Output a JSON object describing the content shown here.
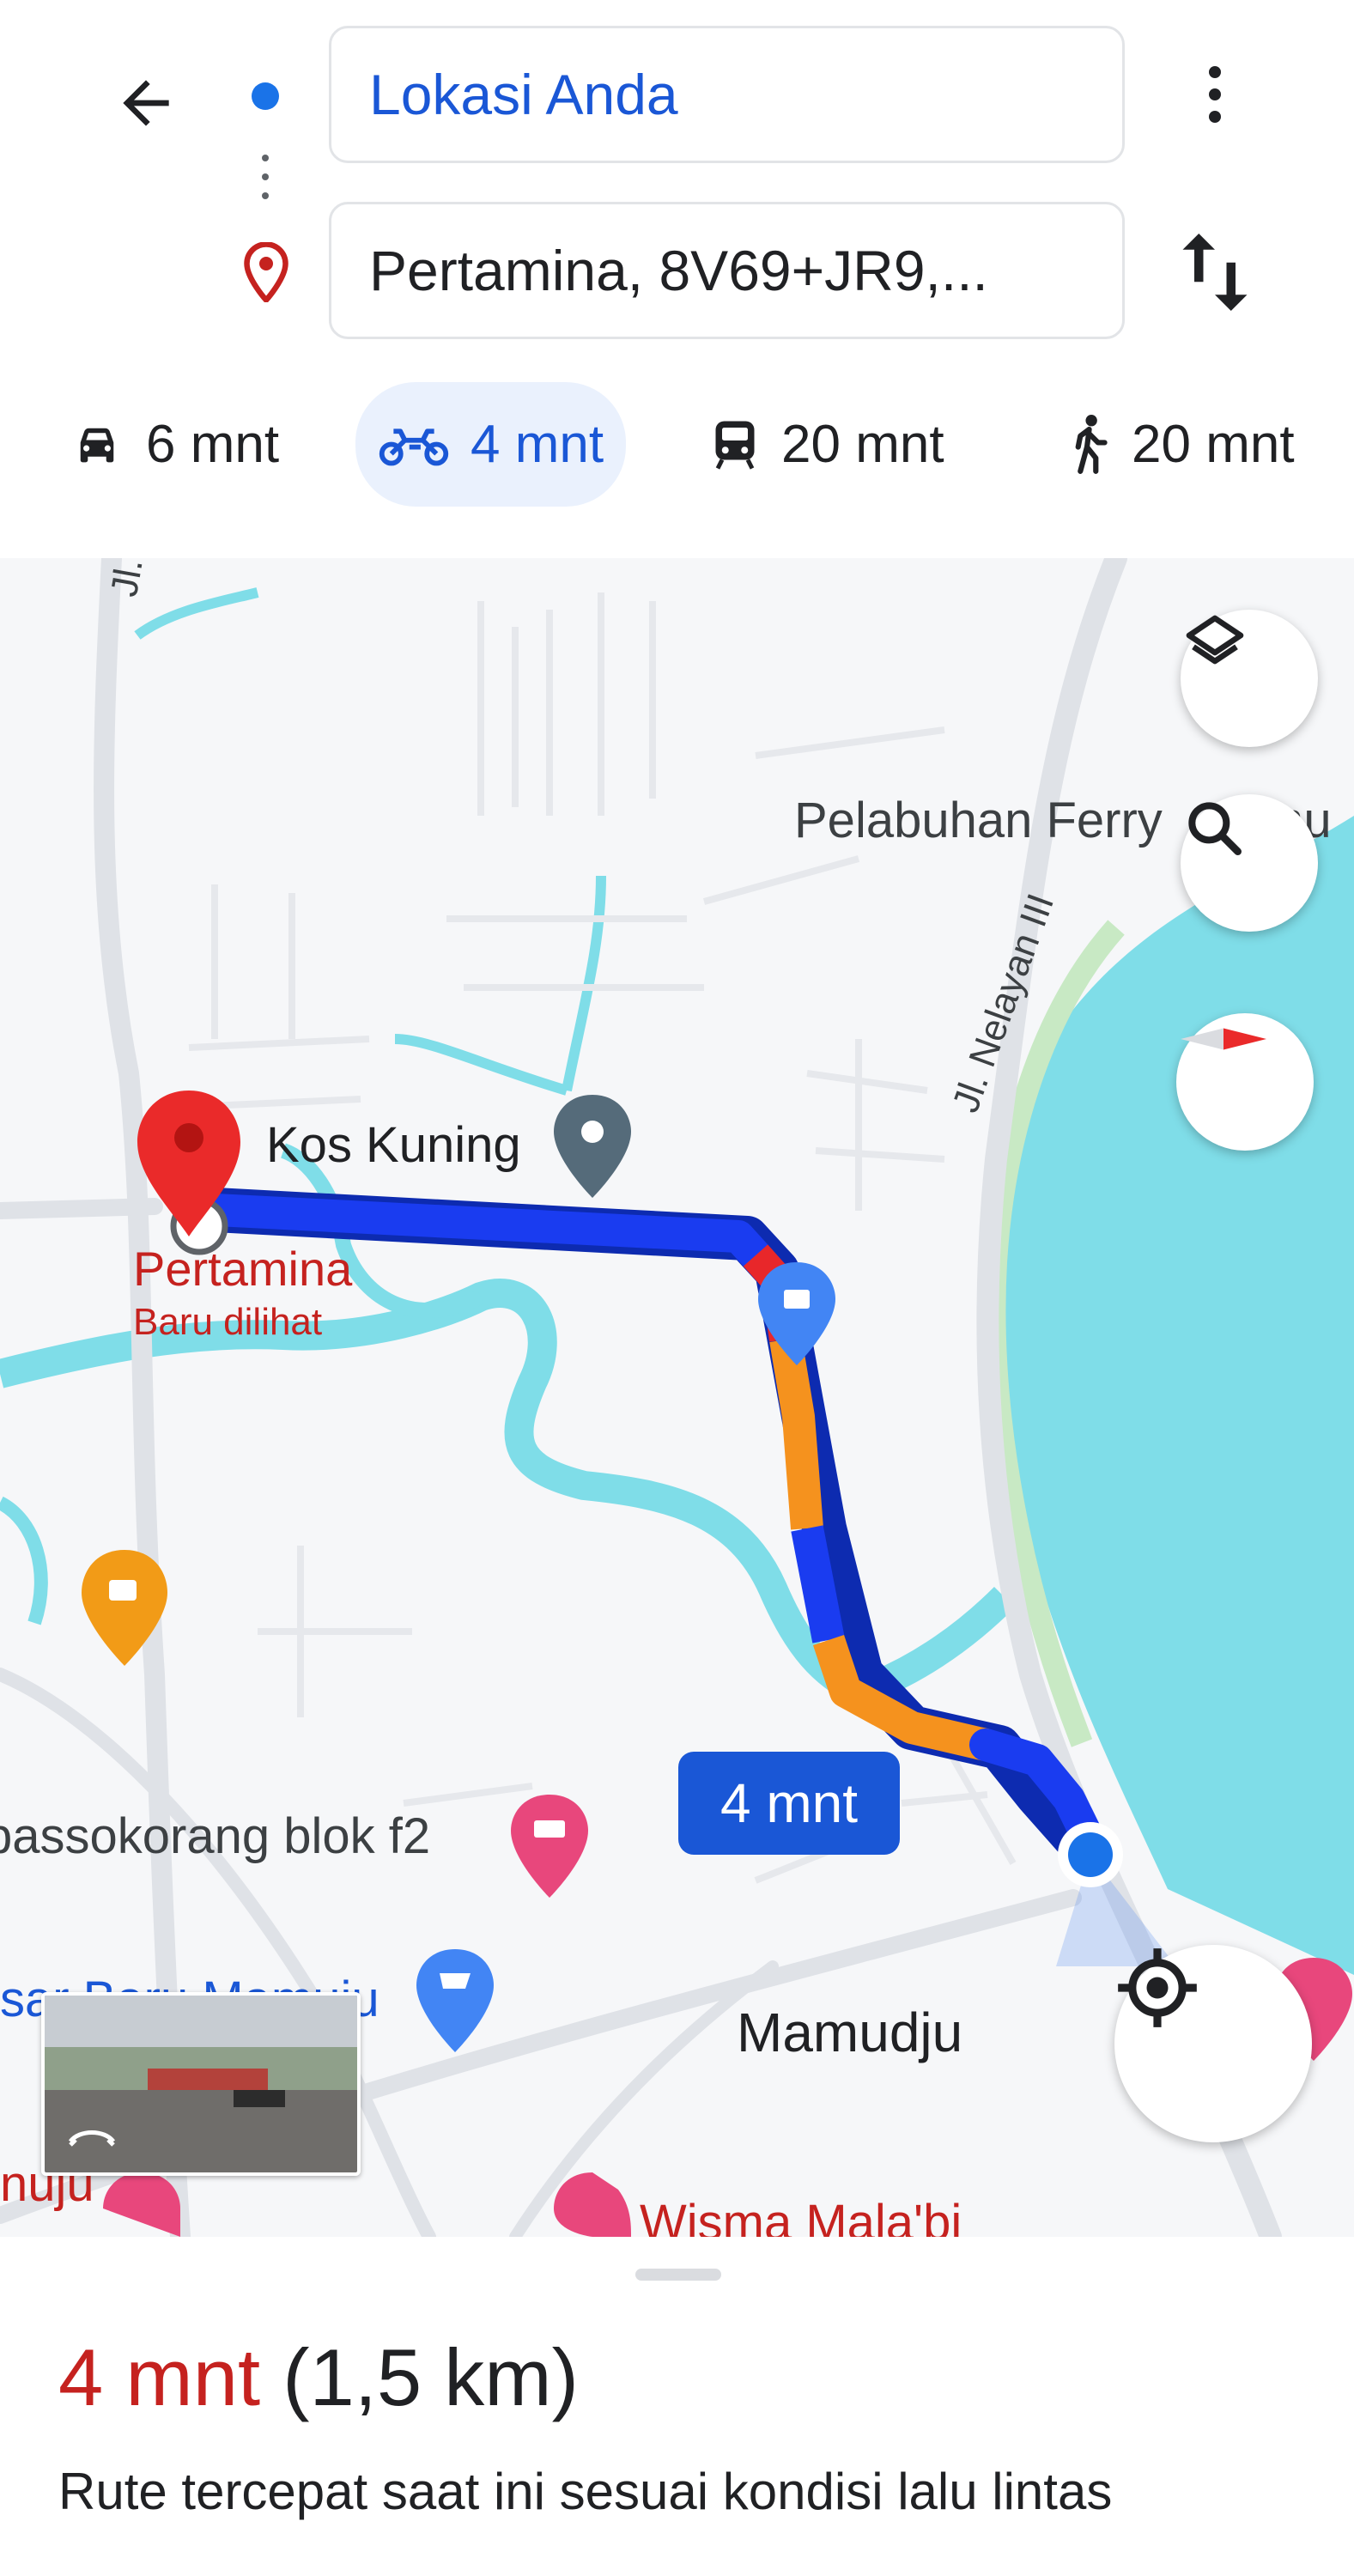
{
  "header": {
    "origin": "Lokasi Anda",
    "destination": "Pertamina, 8V69+JR9,..."
  },
  "modes": [
    {
      "icon": "car-icon",
      "label": "6 mnt",
      "active": false
    },
    {
      "icon": "motorcycle-icon",
      "label": "4 mnt",
      "active": true
    },
    {
      "icon": "transit-icon",
      "label": "20 mnt",
      "active": false
    },
    {
      "icon": "walk-icon",
      "label": "20 mnt",
      "active": false
    }
  ],
  "map": {
    "labels": {
      "street_top": "Jl. I",
      "ferry": "Pelabuhan Ferry",
      "ferry_suffix": "mu",
      "street_nelayan": "Jl. Nelayan III",
      "kos": "Kos Kuning",
      "pertamina": "Pertamina",
      "recently_viewed": "Baru dilihat",
      "passokorang": "passokorang blok f2",
      "pasar": "sar Baru Mamuju",
      "mamudju": "Mamudju",
      "left_bottom": "nuju",
      "wisma": "Wisma Mala'bi"
    },
    "eta_bubble": "4 mnt",
    "colors": {
      "route": "#1a3cf0",
      "traffic_slow": "#f5921e",
      "traffic_heavy": "#e8272a",
      "water": "#7fdde8",
      "destination_pin": "#ea2a2a",
      "current_location": "#1a73e8"
    },
    "controls": [
      "layers-icon",
      "search-icon",
      "compass-icon",
      "my-location-icon"
    ]
  },
  "sheet": {
    "duration": "4 mnt",
    "distance": "(1,5 km)",
    "description": "Rute tercepat saat ini sesuai kondisi lalu lintas"
  }
}
